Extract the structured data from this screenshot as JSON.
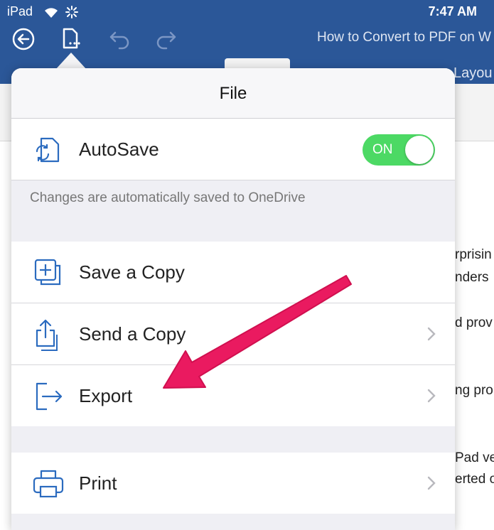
{
  "status": {
    "carrier": "iPad",
    "time": "7:47 AM"
  },
  "toolbar": {
    "doc_title": "How to Convert to PDF on W",
    "layout_tab": "Layou"
  },
  "document": {
    "lines": [
      "rprisin",
      "nders",
      "d prov",
      "ng pro",
      "Pad ve",
      "erted o"
    ]
  },
  "panel": {
    "title": "File",
    "autosave": {
      "label": "AutoSave",
      "toggle": "ON",
      "note": "Changes are automatically saved to OneDrive"
    },
    "items": [
      {
        "label": "Save a Copy",
        "icon": "save-copy-icon"
      },
      {
        "label": "Send a Copy",
        "icon": "share-icon"
      },
      {
        "label": "Export",
        "icon": "export-icon"
      },
      {
        "label": "Print",
        "icon": "print-icon"
      }
    ]
  },
  "colors": {
    "accent": "#2b5798",
    "toggle_on": "#4cd964",
    "arrow": "#ea1a60",
    "icon": "#2b6bbf"
  }
}
